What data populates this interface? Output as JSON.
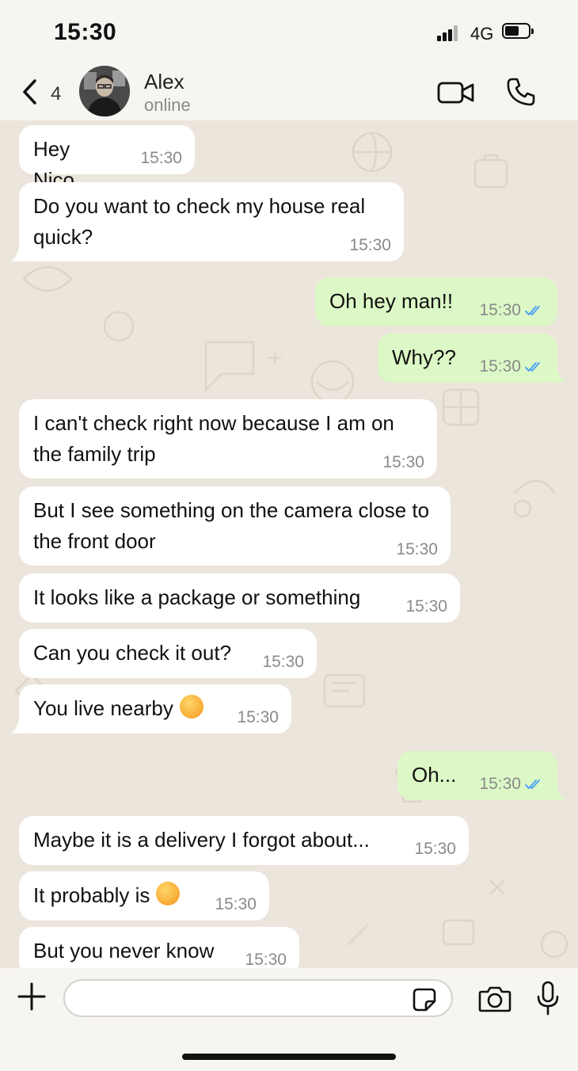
{
  "status_bar": {
    "time": "15:30",
    "network": "4G",
    "battery_level": 0.6
  },
  "header": {
    "unread_count": "4",
    "contact_name": "Alex",
    "contact_status": "online"
  },
  "messages": [
    {
      "dir": "in",
      "text": "Hey Nico",
      "time": "15:30"
    },
    {
      "dir": "in",
      "text": "Do you want to check my house real quick?",
      "time": "15:30"
    },
    {
      "dir": "out",
      "text": "Oh hey man!!",
      "time": "15:30",
      "read": true
    },
    {
      "dir": "out",
      "text": "Why??",
      "time": "15:30",
      "read": true
    },
    {
      "dir": "in",
      "text": "I can't check right now because I am on the family trip",
      "time": "15:30"
    },
    {
      "dir": "in",
      "text": "But I see something on the camera close to the front door",
      "time": "15:30"
    },
    {
      "dir": "in",
      "text": "It looks like a package or something",
      "time": "15:30"
    },
    {
      "dir": "in",
      "text": "Can you check it out?",
      "time": "15:30"
    },
    {
      "dir": "in",
      "text": "You live nearby",
      "time": "15:30",
      "emoji": "zany-face"
    },
    {
      "dir": "out",
      "text": "Oh...",
      "time": "15:30",
      "read": true
    },
    {
      "dir": "in",
      "text": "Maybe it is a delivery I forgot about...",
      "time": "15:30"
    },
    {
      "dir": "in",
      "text": "It probably is",
      "time": "15:30",
      "emoji": "grinning-sweat-face"
    },
    {
      "dir": "in",
      "text": "But you never know",
      "time": "15:30"
    }
  ],
  "input": {
    "placeholder": ""
  },
  "colors": {
    "incoming": "#ffffff",
    "outgoing": "#dcf8c6",
    "read_ticks": "#4fa3f7",
    "background": "#ece5dc"
  },
  "icons": {
    "back": "chevron-left-icon",
    "video": "video-call-icon",
    "call": "phone-icon",
    "attach": "plus-icon",
    "sticker": "sticker-icon",
    "camera": "camera-icon",
    "mic": "microphone-icon"
  }
}
